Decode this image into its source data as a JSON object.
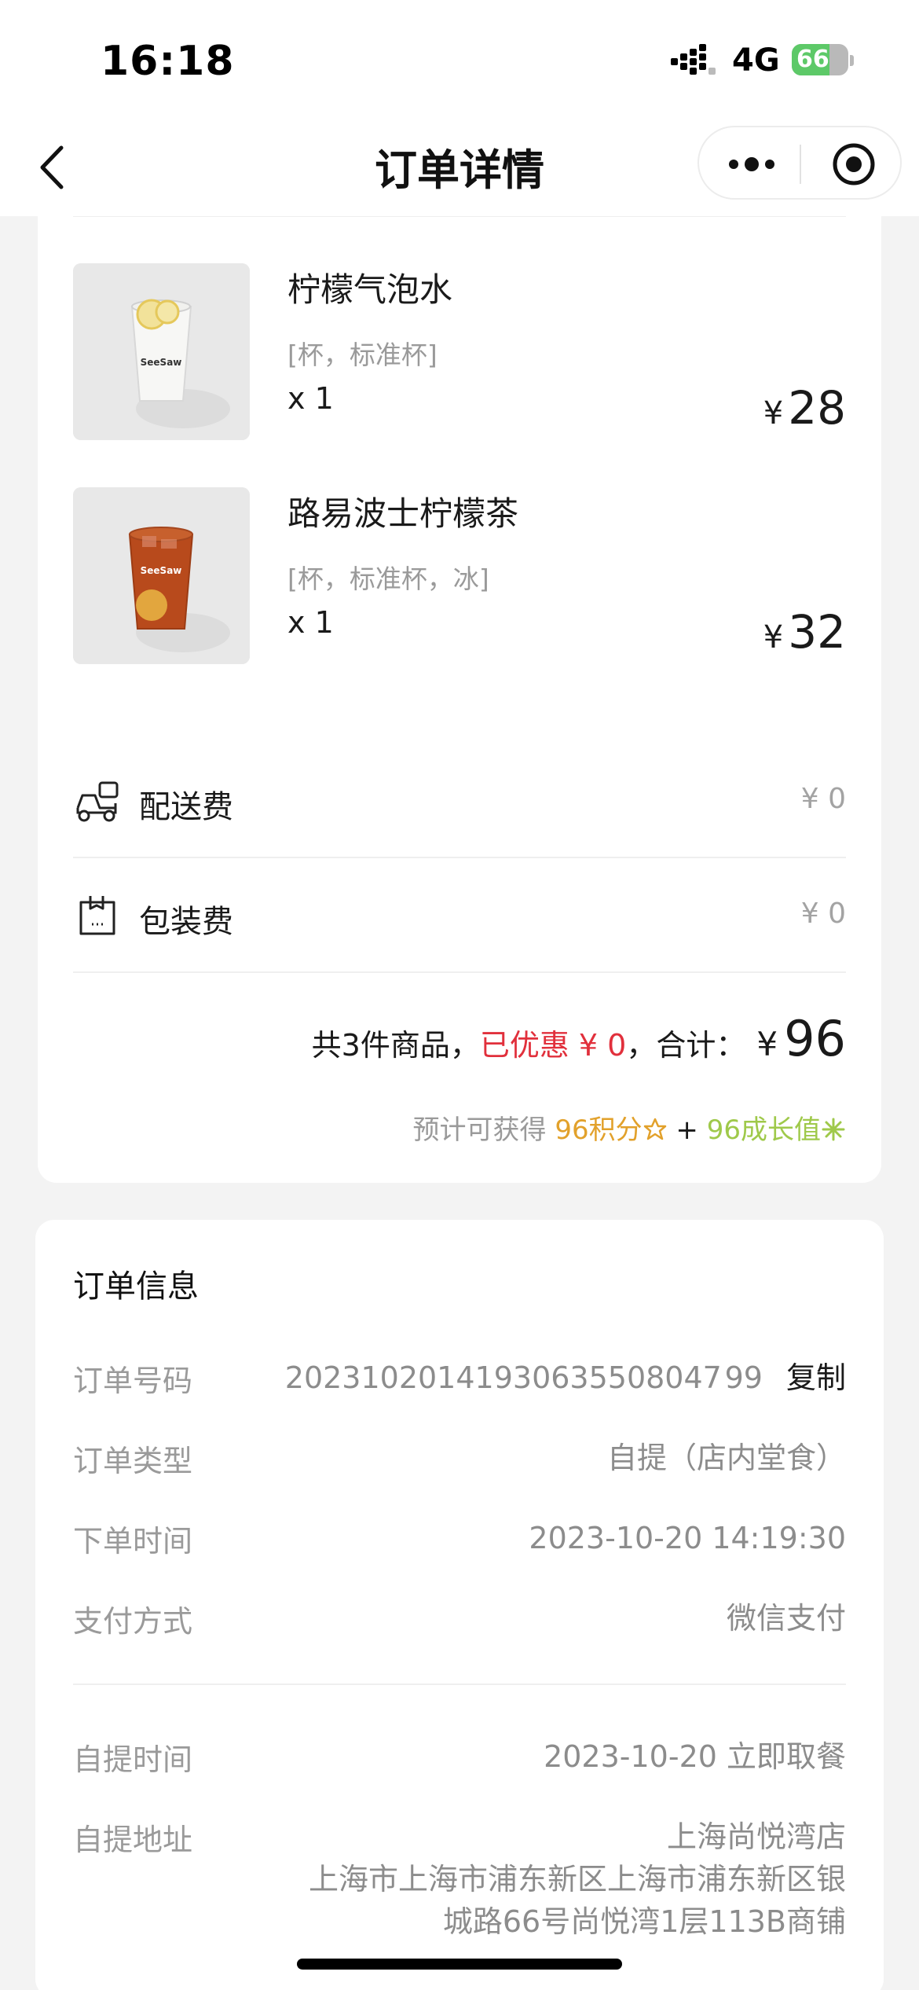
{
  "status_bar": {
    "time": "16:18",
    "network": "4G",
    "battery": "66",
    "battery_level": 0.66
  },
  "nav": {
    "title": "订单详情"
  },
  "products": [
    {
      "name": "柠檬气泡水",
      "spec": "[杯，标准杯]",
      "qty": "x 1",
      "currency": "¥",
      "price": "28",
      "image": "sparkling-lemon-drink"
    },
    {
      "name": "路易波士柠檬茶",
      "spec": "[杯，标准杯，冰]",
      "qty": "x 1",
      "currency": "¥",
      "price": "32",
      "image": "rooibos-lemon-tea"
    }
  ],
  "fees": [
    {
      "label": "配送费",
      "value": "¥ 0",
      "icon": "delivery-scooter-icon"
    },
    {
      "label": "包装费",
      "value": "¥ 0",
      "icon": "package-box-icon"
    }
  ],
  "summary": {
    "count_text": "共3件商品，",
    "discount_text": "已优惠 ¥ 0",
    "total_prefix": "，合计：",
    "total_currency": "¥",
    "total_amount": "96",
    "earn_prefix": "预计可获得 ",
    "earn_points": "96积分",
    "earn_plus": " + ",
    "earn_growth": "96成长值"
  },
  "order_info": {
    "title": "订单信息",
    "order_no_label": "订单号码",
    "order_no": "20231020141930635508047 99",
    "copy_label": "复制",
    "type_label": "订单类型",
    "type_value": "自提（店内堂食）",
    "time_label": "下单时间",
    "time_value": "2023-10-20 14:19:30",
    "pay_label": "支付方式",
    "pay_value": "微信支付",
    "pickup_time_label": "自提时间",
    "pickup_time_value": "2023-10-20 立即取餐",
    "pickup_addr_label": "自提地址",
    "pickup_addr_line1": "上海尚悦湾店",
    "pickup_addr_line2": "上海市上海市浦东新区上海市浦东新区银",
    "pickup_addr_line3": "城路66号尚悦湾1层113B商铺"
  },
  "colors": {
    "accent_red": "#e1303c",
    "points_orange": "#e2a12b",
    "growth_green": "#9fc94a",
    "battery_green": "#5dc968"
  }
}
